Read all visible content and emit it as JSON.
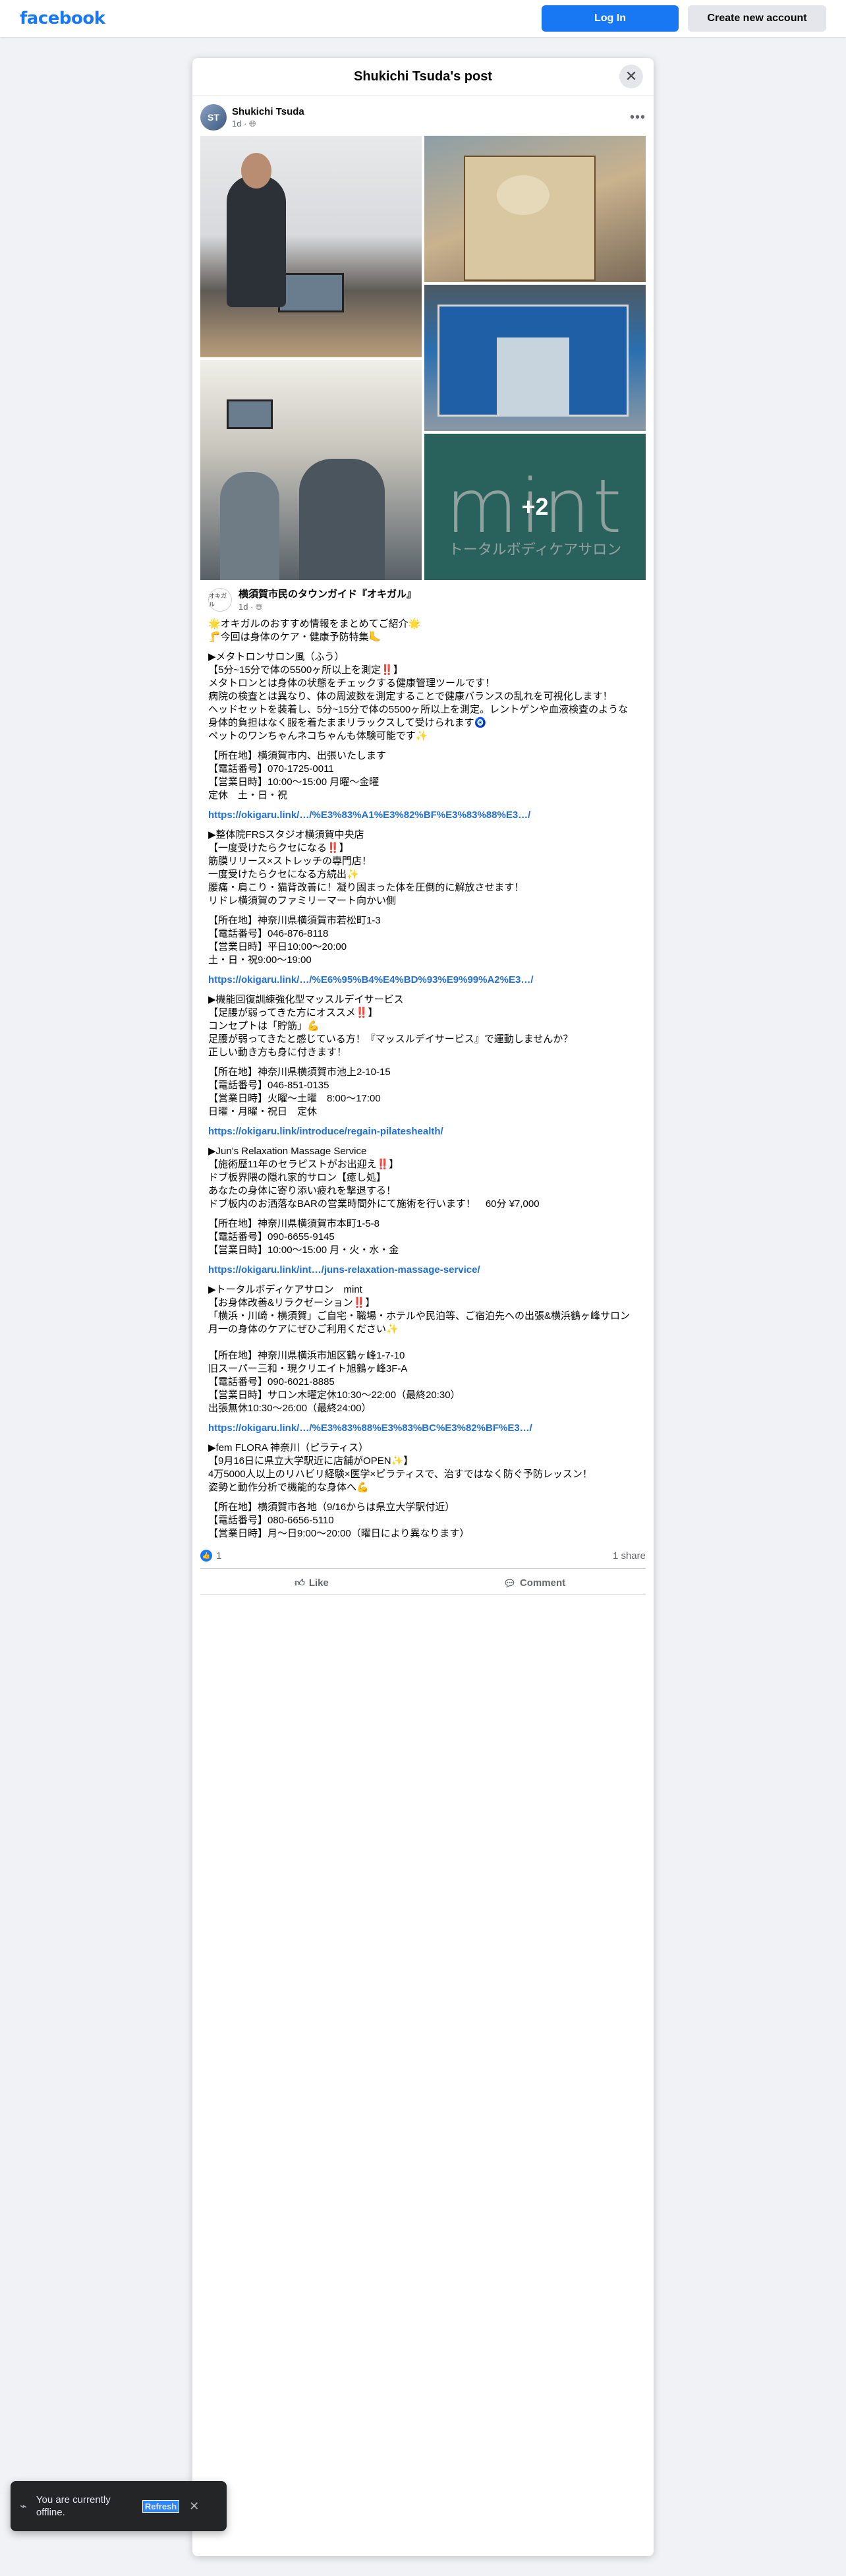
{
  "topbar": {
    "logo": "facebook",
    "login_label": "Log In",
    "create_label": "Create new account"
  },
  "dialog": {
    "title": "Shukichi Tsuda's post",
    "close_icon": "close-icon"
  },
  "post": {
    "author": "Shukichi Tsuda",
    "time": "1d",
    "privacy_icon": "globe-icon",
    "more_overlay": "+2",
    "mint_word": "mint",
    "mint_sub": "トータルボディケアサロン",
    "page": {
      "name": "横須賀市民のタウンガイド『オキガル』",
      "time": "1d",
      "avatar_text": "オキガル"
    },
    "paragraphs": [
      {
        "lines": [
          "🌟オキガルのおすすめ情報をまとめてご紹介🌟",
          "🦵今回は身体のケア・健康予防特集🦶"
        ]
      },
      {
        "lines": [
          "▶メタトロンサロン風（ふう）",
          "【5分~15分で体の5500ヶ所以上を測定‼️】",
          "メタトロンとは身体の状態をチェックする健康管理ツールです！",
          "病院の検査とは異なり、体の周波数を測定することで健康バランスの乱れを可視化します！",
          "ヘッドセットを装着し、5分~15分で体の5500ヶ所以上を測定。レントゲンや血液検査のような身体的負担はなく服を着たままリラックスして受けられます🧿",
          "ペットのワンちゃんネコちゃんも体験可能です✨"
        ]
      },
      {
        "lines": [
          "【所在地】横須賀市内、出張いたします",
          "【電話番号】070-1725-0011",
          "【営業日時】10:00〜15:00 月曜〜金曜",
          "定休　土・日・祝"
        ]
      },
      {
        "lines": [
          "https://okigaru.link/…/%E3%83%A1%E3%82%BF%E3%83%88%E3…/"
        ],
        "link": true
      },
      {
        "lines": [
          "▶整体院FRSスタジオ横須賀中央店",
          "【一度受けたらクセになる‼️】",
          "筋膜リリース×ストレッチの専門店！",
          "一度受けたらクセになる方続出✨",
          "腰痛・肩こり・猫背改善に！凝り固まった体を圧倒的に解放させます！",
          "リドレ横須賀のファミリーマート向かい側"
        ]
      },
      {
        "lines": [
          "【所在地】神奈川県横須賀市若松町1-3",
          "【電話番号】046-876-8118",
          "【営業日時】平日10:00〜20:00",
          "土・日・祝9:00〜19:00"
        ]
      },
      {
        "lines": [
          "https://okigaru.link/…/%E6%95%B4%E4%BD%93%E9%99%A2%E3…/"
        ],
        "link": true
      },
      {
        "lines": [
          "▶機能回復訓練強化型マッスルデイサービス",
          "【足腰が弱ってきた方にオススメ‼️】",
          "コンセプトは「貯筋」💪",
          "足腰が弱ってきたと感じている方！『マッスルデイサービス』で運動しませんか？",
          "正しい動き方も身に付きます！"
        ]
      },
      {
        "lines": [
          "【所在地】神奈川県横須賀市池上2-10-15",
          "【電話番号】046-851-0135",
          "【営業日時】火曜〜土曜　8:00〜17:00",
          "日曜・月曜・祝日　定休"
        ]
      },
      {
        "lines": [
          "https://okigaru.link/introduce/regain-pilateshealth/"
        ],
        "link": true
      },
      {
        "lines": [
          "▶Jun's Relaxation Massage Service",
          "【施術歴11年のセラピストがお出迎え‼️】",
          "ドブ板界隈の隠れ家的サロン【癒し処】",
          "あなたの身体に寄り添い疲れを撃退する！",
          "ドブ板内のお洒落なBARの営業時間外にて施術を行います！　60分 ¥7,000"
        ]
      },
      {
        "lines": [
          "【所在地】神奈川県横須賀市本町1-5-8",
          "【電話番号】090-6655-9145",
          "【営業日時】10:00〜15:00 月・火・水・金"
        ]
      },
      {
        "lines": [
          "https://okigaru.link/int…/juns-relaxation-massage-service/"
        ],
        "link": true
      },
      {
        "lines": [
          "▶トータルボディケアサロン　mint",
          "【お身体改善&リラクゼーション‼️】",
          "「横浜・川崎・横須賀」ご自宅・職場・ホテルや民泊等、ご宿泊先への出張&横浜鶴ヶ峰サロン",
          "月一の身体のケアにぜひご利用ください✨",
          "",
          "【所在地】神奈川県横浜市旭区鶴ヶ峰1-7-10",
          "旧スーパー三和・現クリエイト旭鶴ヶ峰3F-A",
          "【電話番号】090-6021-8885",
          "【営業日時】サロン木曜定休10:30〜22:00（最終20:30）",
          "出張無休10:30〜26:00（最終24:00）"
        ]
      },
      {
        "lines": [
          "https://okigaru.link/…/%E3%83%88%E3%83%BC%E3%82%BF%E3…/"
        ],
        "link": true
      },
      {
        "lines": [
          "▶fem FLORA 神奈川（ピラティス）",
          "【9月16日に県立大学駅近に店舗がOPEN✨】",
          "4万5000人以上のリハビリ経験×医学×ピラティスで、治すではなく防ぐ予防レッスン！",
          "姿勢と動作分析で機能的な身体へ💪"
        ]
      },
      {
        "lines": [
          "【所在地】横須賀市各地（9/16からは県立大学駅付近）",
          "【電話番号】080-6656-5110",
          "【営業日時】月〜日9:00〜20:00（曜日により異なります）"
        ]
      }
    ],
    "reactions_count": "1",
    "shares": "1 share",
    "like_label": "Like",
    "comment_label": "Comment"
  },
  "toast": {
    "text": "You are currently offline.",
    "refresh_label": "Refresh",
    "close_icon": "close-icon"
  }
}
